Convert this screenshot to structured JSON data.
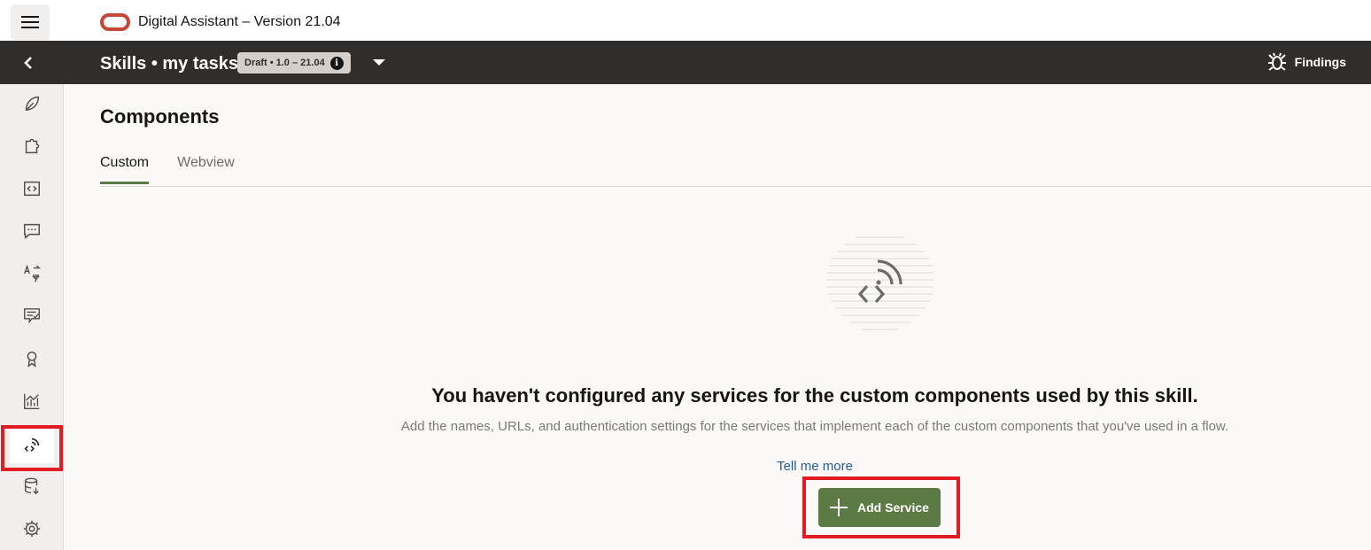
{
  "app": {
    "title": "Digital Assistant – Version 21.04"
  },
  "header": {
    "skill_title": "Skills • my tasks",
    "version_badge": "Draft • 1.0 – 21.04",
    "findings_label": "Findings"
  },
  "sidebar": {
    "items": [
      {
        "name": "leaf-icon",
        "active": false
      },
      {
        "name": "puzzle-icon",
        "active": false
      },
      {
        "name": "code-entity-icon",
        "active": false
      },
      {
        "name": "chat-bubble-icon",
        "active": false
      },
      {
        "name": "translate-icon",
        "active": false
      },
      {
        "name": "quality-list-icon",
        "active": false
      },
      {
        "name": "award-ribbon-icon",
        "active": false
      },
      {
        "name": "analytics-chart-icon",
        "active": false
      },
      {
        "name": "custom-components-icon",
        "active": true
      },
      {
        "name": "database-icon",
        "active": false
      },
      {
        "name": "settings-gear-icon",
        "active": false
      }
    ]
  },
  "main": {
    "page_title": "Components",
    "tabs": [
      {
        "label": "Custom",
        "active": true
      },
      {
        "label": "Webview",
        "active": false
      }
    ],
    "empty_state": {
      "heading": "You haven't configured any services for the custom components used by this skill.",
      "description": "Add the names, URLs, and authentication settings for the services that implement each of the custom components that you've used in a flow.",
      "link": "Tell me more",
      "button_label": "Add Service"
    }
  },
  "colors": {
    "brand_red": "#c74634",
    "header_dark": "#312d2a",
    "primary_green": "#5b7a44",
    "highlight_red": "#e31b23",
    "link_blue": "#1f5c99"
  }
}
